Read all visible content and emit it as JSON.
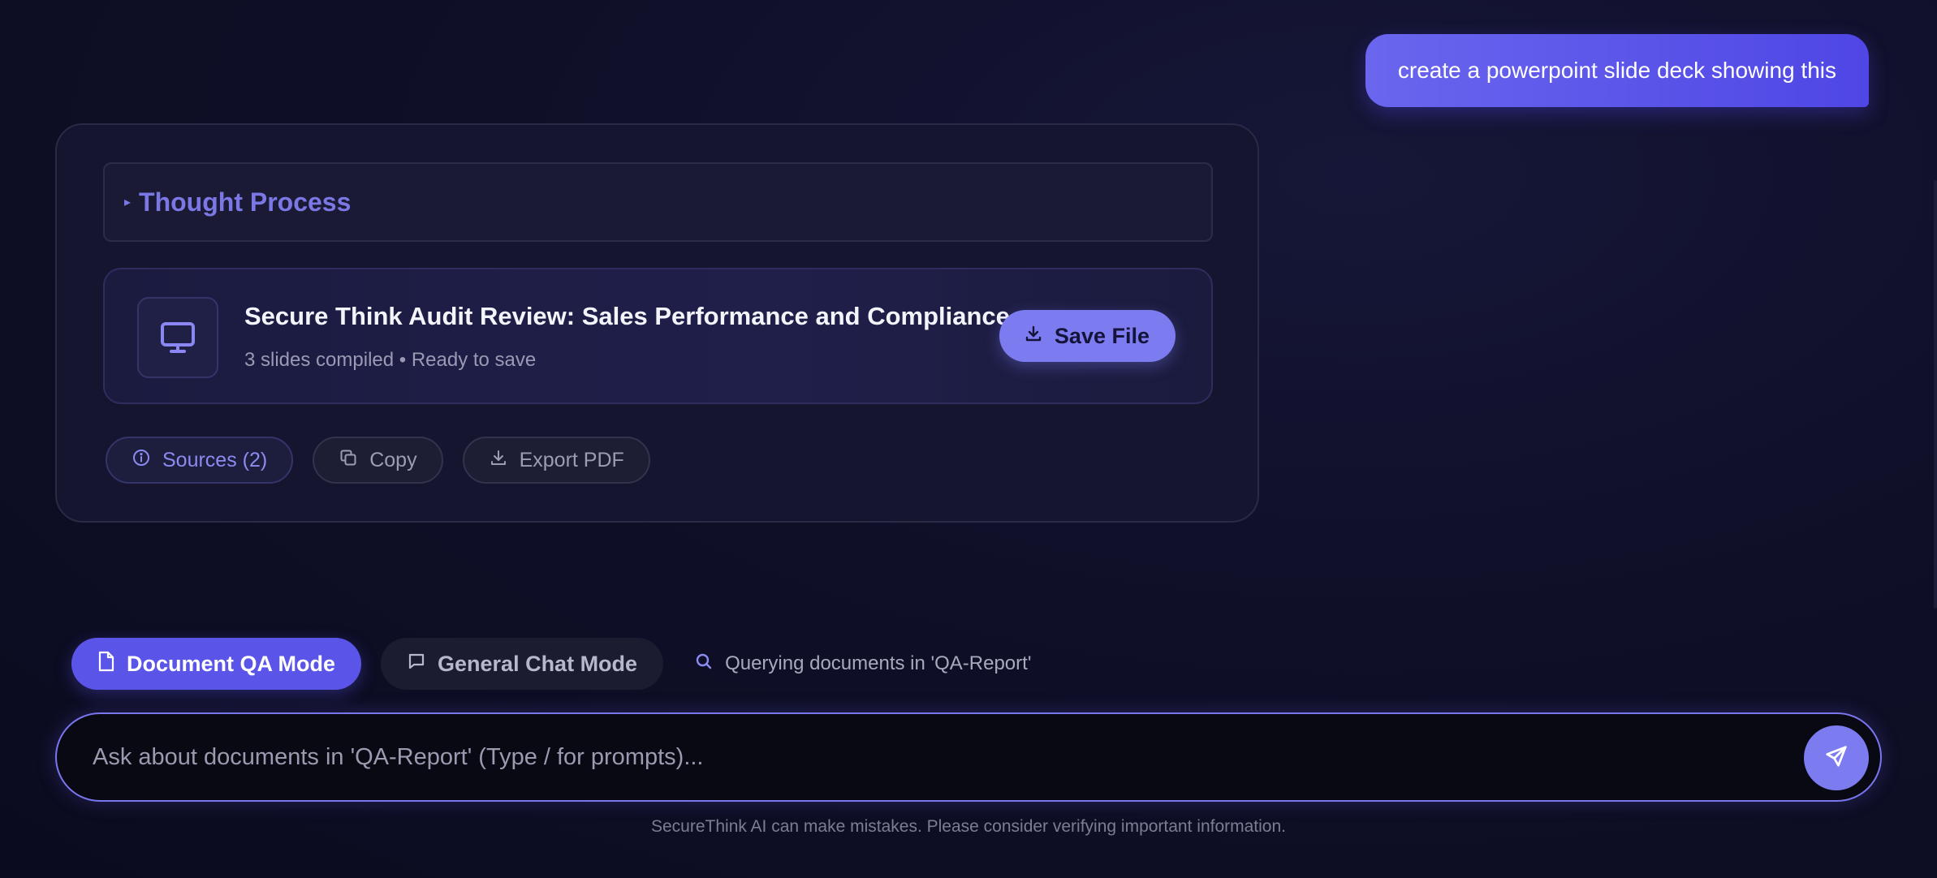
{
  "chat": {
    "user_message": "create a powerpoint slide deck showing this"
  },
  "assistant": {
    "thought_process_label": "Thought Process",
    "file": {
      "icon": "monitor-icon",
      "title": "Secure Think Audit Review: Sales Performance and Compliance",
      "meta": "3 slides compiled • Ready to save",
      "save_label": "Save File"
    },
    "actions": {
      "sources_label": "Sources (2)",
      "copy_label": "Copy",
      "export_label": "Export PDF"
    }
  },
  "modes": {
    "document_qa_label": "Document QA Mode",
    "general_chat_label": "General Chat Mode",
    "query_status": "Querying documents in 'QA-Report'"
  },
  "composer": {
    "placeholder": "Ask about documents in 'QA-Report' (Type / for prompts)...",
    "value": ""
  },
  "footer": {
    "disclaimer": "SecureThink AI can make mistakes. Please consider verifying important information."
  },
  "colors": {
    "accent": "#7c7cf0",
    "accent_strong": "#5a55e8",
    "background": "#0f0f28"
  }
}
